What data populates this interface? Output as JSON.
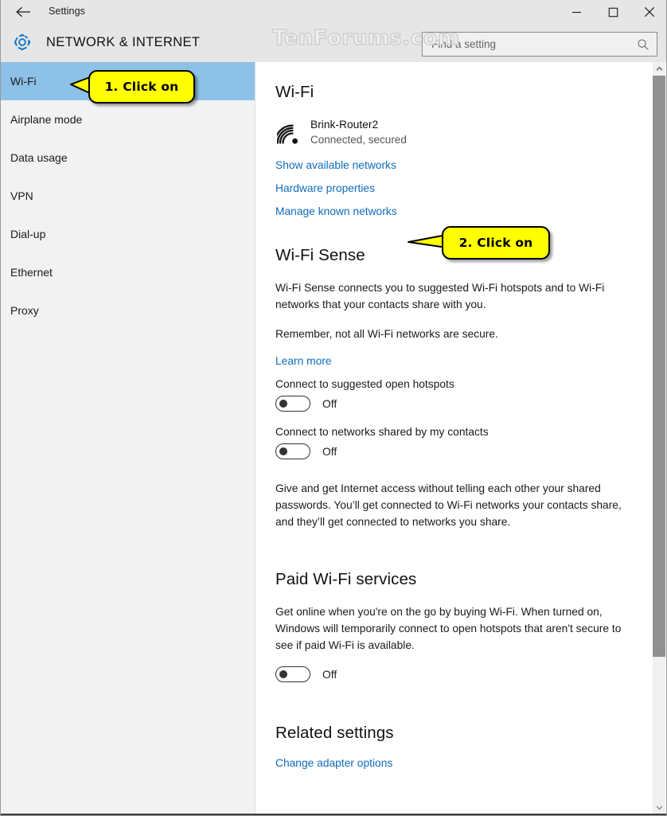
{
  "window": {
    "title": "Settings",
    "back_icon": "back-arrow-icon",
    "minimize_label": "—",
    "maximize_label": "□",
    "close_label": "✕"
  },
  "header": {
    "gear_icon": "gear-icon",
    "page_title": "NETWORK & INTERNET",
    "accent_color": "#0f6cbd"
  },
  "search": {
    "placeholder": "Find a setting",
    "value": "",
    "icon": "search-icon"
  },
  "watermark": {
    "text": "TenForums.com"
  },
  "sidebar": {
    "items": [
      {
        "label": "Wi-Fi",
        "selected": true
      },
      {
        "label": "Airplane mode",
        "selected": false
      },
      {
        "label": "Data usage",
        "selected": false
      },
      {
        "label": "VPN",
        "selected": false
      },
      {
        "label": "Dial-up",
        "selected": false
      },
      {
        "label": "Ethernet",
        "selected": false
      },
      {
        "label": "Proxy",
        "selected": false
      }
    ],
    "selected_bg": "#8ec1e8"
  },
  "main": {
    "wifi": {
      "heading": "Wi-Fi",
      "network_icon": "wifi-signal-icon",
      "network_name": "Brink-Router2",
      "network_status": "Connected, secured",
      "links": [
        "Show available networks",
        "Hardware properties",
        "Manage known networks"
      ]
    },
    "wifi_sense": {
      "heading": "Wi-Fi Sense",
      "paragraph1": "Wi-Fi Sense connects you to suggested Wi-Fi hotspots and to Wi-Fi networks that your contacts share with you.",
      "paragraph2": "Remember, not all Wi-Fi networks are secure.",
      "learn_more": "Learn more",
      "toggles": [
        {
          "label": "Connect to suggested open hotspots",
          "state": "Off",
          "on": false
        },
        {
          "label": "Connect to networks shared by my contacts",
          "state": "Off",
          "on": false
        }
      ],
      "paragraph3": "Give and get Internet access without telling each other your shared passwords. You’ll get connected to Wi-Fi networks your contacts share, and they’ll get connected to networks you share."
    },
    "paid_wifi": {
      "heading": "Paid Wi-Fi services",
      "paragraph": "Get online when you're on the go by buying Wi-Fi. When turned on, Windows will temporarily connect to open hotspots that aren't secure to see if paid Wi-Fi is available.",
      "toggle": {
        "state": "Off",
        "on": false
      }
    },
    "related": {
      "heading": "Related settings",
      "link": "Change adapter options"
    }
  },
  "scrollbar": {
    "up_arrow": "chevron-up-icon",
    "down_arrow": "chevron-down-icon"
  },
  "callouts": [
    {
      "text": "1. Click on",
      "color": "#ffff00"
    },
    {
      "text": "2. Click on",
      "color": "#ffff00"
    }
  ]
}
